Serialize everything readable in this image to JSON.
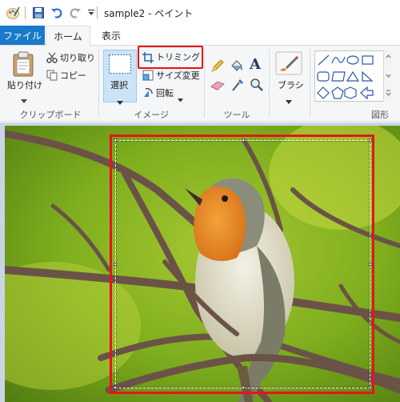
{
  "titlebar": {
    "title": "sample2 - ペイント",
    "icons": [
      "paint-app-icon",
      "save-icon",
      "undo-icon",
      "redo-icon",
      "customize-dropdown-icon"
    ]
  },
  "tabs": [
    {
      "label": "ファイル",
      "active": false,
      "accent": "#1979ca"
    },
    {
      "label": "ホーム",
      "active": true
    },
    {
      "label": "表示",
      "active": false
    }
  ],
  "ribbon": {
    "clipboard": {
      "paste_label": "貼り付け",
      "cut_label": "切り取り",
      "copy_label": "コピー",
      "group_label": "クリップボード"
    },
    "image": {
      "select_label": "選択",
      "crop_label": "トリミング",
      "resize_label": "サイズ変更",
      "rotate_label": "回転",
      "group_label": "イメージ"
    },
    "tools": {
      "icons": [
        "pencil-icon",
        "fill-bucket-icon",
        "text-icon",
        "eraser-icon",
        "color-picker-icon",
        "magnifier-icon"
      ],
      "text_tool_glyph": "A",
      "group_label": "ツール"
    },
    "brushes": {
      "label": "ブラシ"
    },
    "shapes": {
      "group_label": "図形"
    }
  },
  "canvas": {
    "image_subject": "robin-on-branch-photo",
    "highlight_color": "#e8141a"
  }
}
